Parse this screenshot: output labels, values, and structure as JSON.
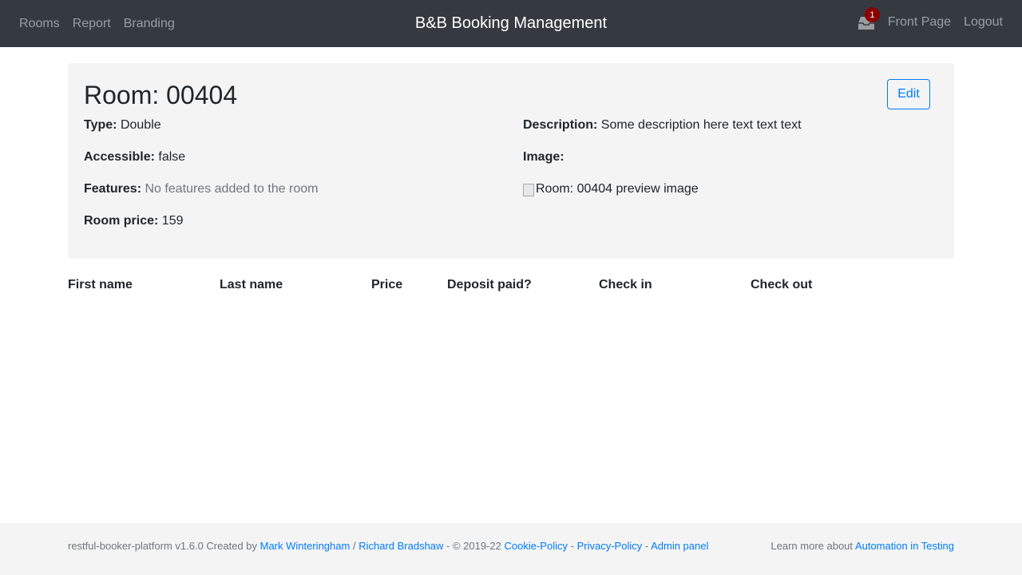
{
  "navbar": {
    "links": [
      "Rooms",
      "Report",
      "Branding"
    ],
    "brand": "B&B Booking Management",
    "notification_count": "1",
    "front_page": "Front Page",
    "logout": "Logout"
  },
  "room": {
    "title": "Room: 00404",
    "edit_label": "Edit",
    "type_label": "Type:",
    "type_value": "Double",
    "accessible_label": "Accessible:",
    "accessible_value": "false",
    "features_label": "Features:",
    "features_value": "No features added to the room",
    "price_label": "Room price:",
    "price_value": "159",
    "description_label": "Description:",
    "description_value": "Some description here text text text",
    "image_label": "Image:",
    "image_alt": "Room: 00404 preview image"
  },
  "bookings_table": {
    "headers": [
      "First name",
      "Last name",
      "Price",
      "Deposit paid?",
      "Check in",
      "Check out"
    ]
  },
  "footer": {
    "prefix": "restful-booker-platform v1.6.0 Created by",
    "author1": "Mark Winteringham",
    "separator": "/",
    "author2": "Richard Bradshaw",
    "copyright": "- © 2019-22",
    "cookie_policy": "Cookie-Policy",
    "dash1": "-",
    "privacy_policy": "Privacy-Policy",
    "dash2": "-",
    "admin_panel": "Admin panel",
    "learn_more": "Learn more about",
    "automation_link": "Automation in Testing"
  },
  "colors": {
    "navbar_bg": "#343a40",
    "card_bg": "#f4f4f4",
    "link": "#007bff",
    "badge": "#8b0000"
  }
}
